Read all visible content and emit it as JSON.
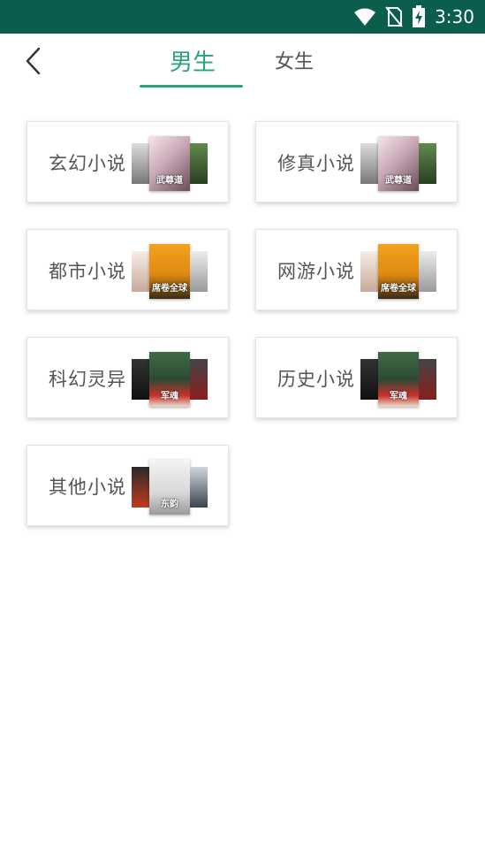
{
  "status_bar": {
    "time": "3:30",
    "icons": [
      "wifi-icon",
      "no-sim-icon",
      "battery-charging-icon"
    ]
  },
  "header": {
    "back_icon": "chevron-left-icon",
    "tabs": [
      {
        "label": "男生",
        "active": true
      },
      {
        "label": "女生",
        "active": false
      }
    ]
  },
  "colors": {
    "status_bar": "#0b5e4e",
    "accent": "#27a37d"
  },
  "categories": [
    {
      "label": "玄幻小说",
      "cover_text": "武尊道"
    },
    {
      "label": "修真小说",
      "cover_text": "武尊道"
    },
    {
      "label": "都市小说",
      "cover_text": "席卷全球"
    },
    {
      "label": "网游小说",
      "cover_text": "席卷全球"
    },
    {
      "label": "科幻灵异",
      "cover_text": "军魂"
    },
    {
      "label": "历史小说",
      "cover_text": "军魂"
    },
    {
      "label": "其他小说",
      "cover_text": "东韵"
    }
  ]
}
